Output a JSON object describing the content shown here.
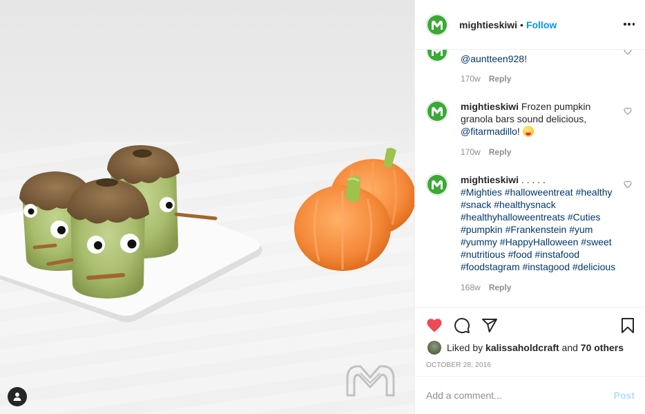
{
  "post": {
    "username": "mightieskiwi",
    "separator": "•",
    "follow_label": "Follow",
    "more_icon": "more-options-icon"
  },
  "comments": [
    {
      "username": "mightieskiwi",
      "mention": "@auntteen928",
      "tail": "!",
      "time": "170w",
      "reply_label": "Reply"
    },
    {
      "username": "mightieskiwi",
      "text": "Frozen pumpkin granola bars sound delicious,",
      "mention": "@fitarmadillo",
      "tail": "!",
      "emoji": "face-savoring-food-emoji",
      "time": "170w",
      "reply_label": "Reply"
    },
    {
      "username": "mightieskiwi",
      "text": ". . . . .",
      "hashtags": "#Mighties #halloweentreat #healthy #snack #healthysnack #healthyhalloweentreats #Cuties #pumpkin #Frankenstein #yum #yummy #HappyHalloween #sweet #nutritious #food #instafood #foodstagram #instagood #delicious",
      "time": "168w",
      "reply_label": "Reply"
    }
  ],
  "likes": {
    "prefix": "Liked by",
    "user": "kalissaholdcraft",
    "and": "and",
    "others": "70 others"
  },
  "date": "OCTOBER 28, 2016",
  "add_comment": {
    "placeholder": "Add a comment...",
    "post_label": "Post"
  },
  "colors": {
    "link": "#0095f6",
    "mention": "#00376b",
    "like_red": "#ed4956",
    "brand_green": "#3aa935"
  }
}
